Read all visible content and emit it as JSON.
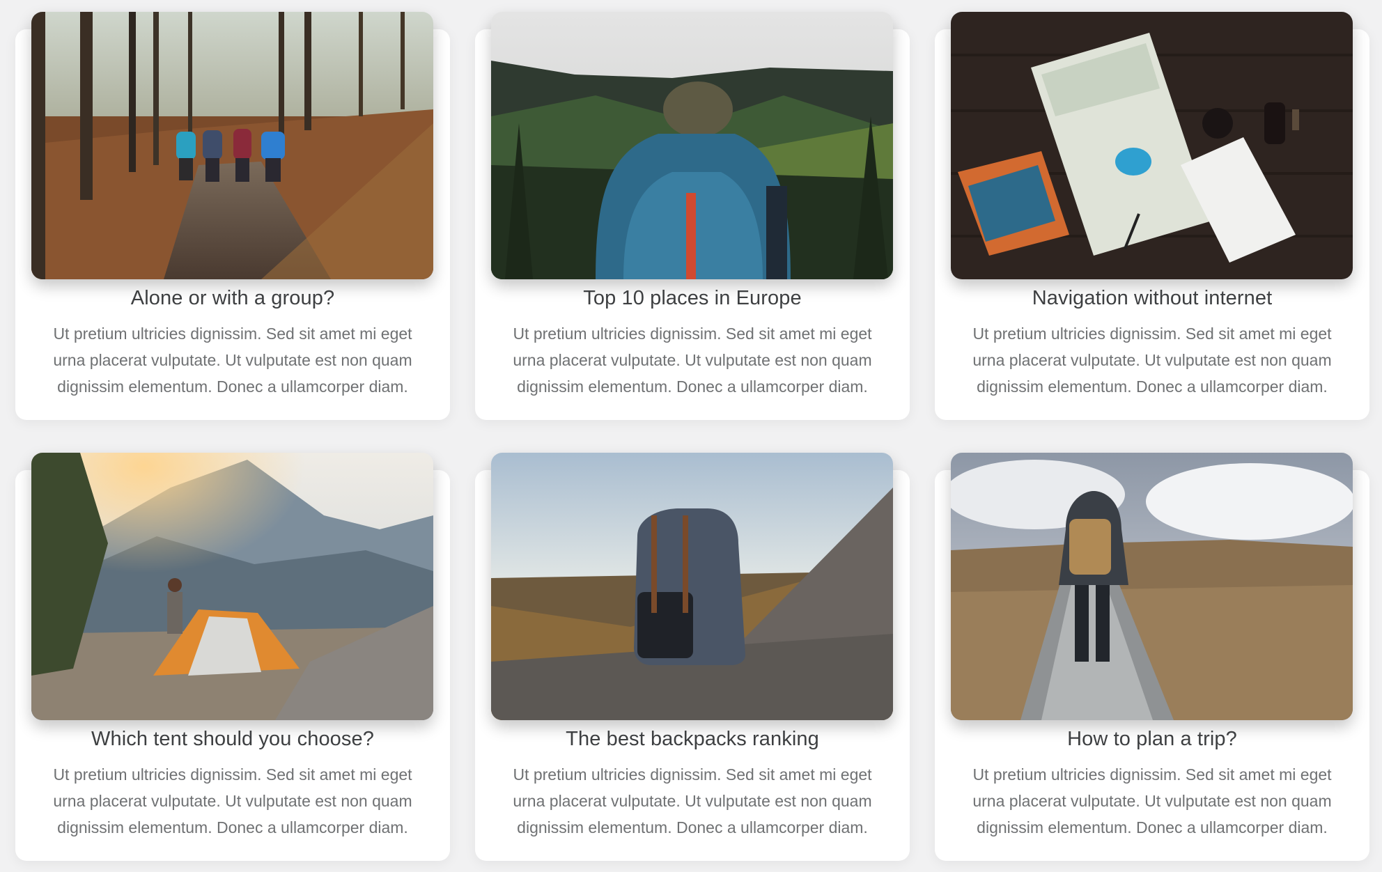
{
  "cards": [
    {
      "title": "Alone or with a group?",
      "text": "Ut pretium ultricies dignissim. Sed sit amet mi eget urna placerat vulputate. Ut vulputate est non quam dignissim elementum. Donec a ullamcorper diam.",
      "image": "forest-hikers-photo"
    },
    {
      "title": "Top 10 places in Europe",
      "text": "Ut pretium ultricies dignissim. Sed sit amet mi eget urna placerat vulputate. Ut vulputate est non quam dignissim elementum. Donec a ullamcorper diam.",
      "image": "backpacker-valley-photo"
    },
    {
      "title": "Navigation without internet",
      "text": "Ut pretium ultricies dignissim. Sed sit amet mi eget urna placerat vulputate. Ut vulputate est non quam dignissim elementum. Donec a ullamcorper diam.",
      "image": "paper-map-table-photo"
    },
    {
      "title": "Which tent should you choose?",
      "text": "Ut pretium ultricies dignissim. Sed sit amet mi eget urna placerat vulputate. Ut vulputate est non quam dignissim elementum. Donec a ullamcorper diam.",
      "image": "mountain-tent-photo"
    },
    {
      "title": "The best backpacks ranking",
      "text": "Ut pretium ultricies dignissim. Sed sit amet mi eget urna placerat vulputate. Ut vulputate est non quam dignissim elementum. Donec a ullamcorper diam.",
      "image": "backpack-rocks-photo"
    },
    {
      "title": "How to plan a trip?",
      "text": "Ut pretium ultricies dignissim. Sed sit amet mi eget urna placerat vulputate. Ut vulputate est non quam dignissim elementum. Donec a ullamcorper diam.",
      "image": "hiker-stone-path-photo"
    }
  ]
}
